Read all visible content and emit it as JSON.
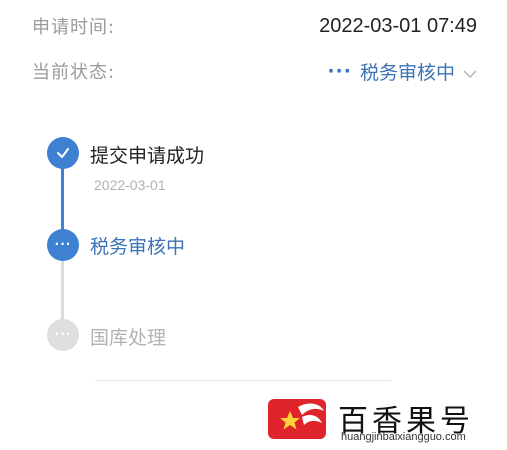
{
  "summary": {
    "time_label": "申请时间:",
    "time_value": "2022-03-01 07:49",
    "status_label": "当前状态:",
    "status_dots": "···",
    "status_value": "税务审核中",
    "status_icon": "chevron-down-icon"
  },
  "timeline": {
    "steps": [
      {
        "title": "提交申请成功",
        "date": "2022-03-01",
        "state": "done",
        "icon": "check-icon"
      },
      {
        "title": "税务审核中",
        "state": "active",
        "icon": "dots-icon",
        "icon_text": "···"
      },
      {
        "title": "国库处理",
        "state": "pending",
        "icon": "dots-icon",
        "icon_text": "···"
      }
    ]
  },
  "watermark": {
    "brand": "百香果号",
    "url": "huangjinbaixiangguo.com"
  },
  "colors": {
    "accent": "#3e80d2",
    "active_text": "#3a73b8",
    "pending": "#dedede",
    "label_grey": "#9a9a9a"
  }
}
